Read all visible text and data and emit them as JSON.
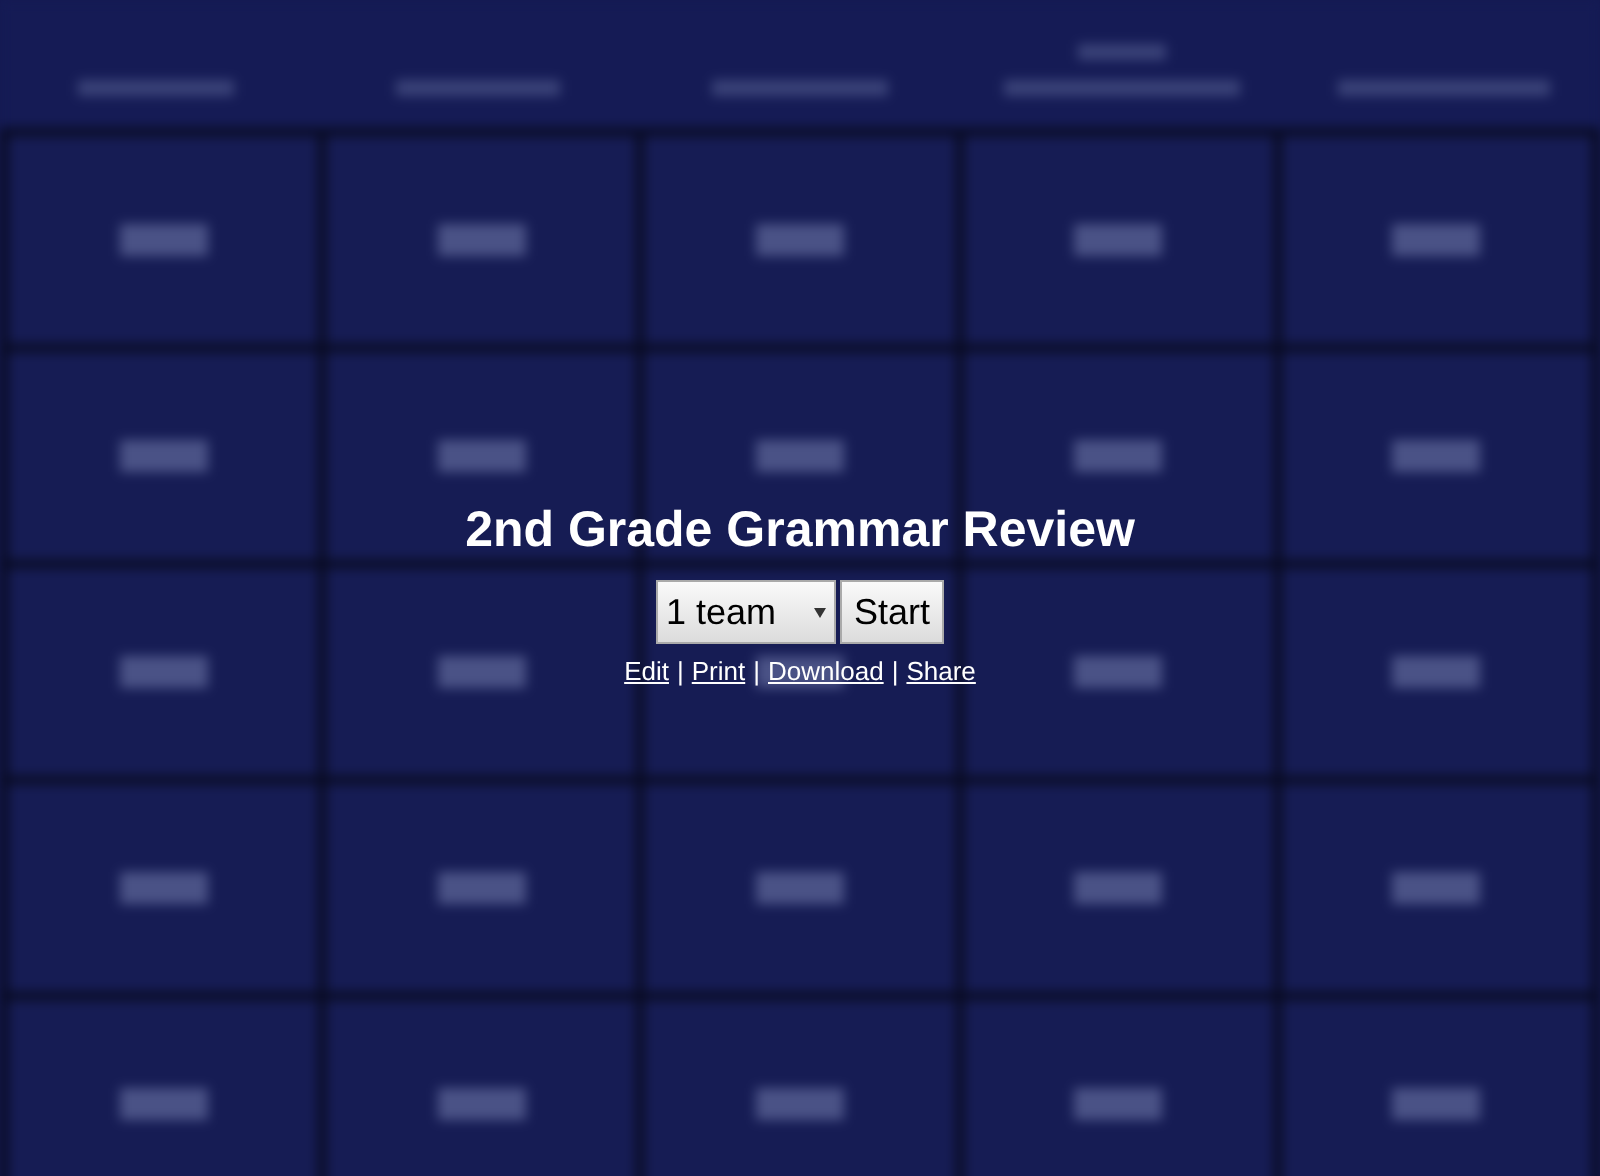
{
  "title": "2nd Grade Grammar Review",
  "team_select": {
    "value": "1 team"
  },
  "start_button": "Start",
  "links": [
    "Edit",
    "Print",
    "Download",
    "Share"
  ],
  "link_separator": "|"
}
